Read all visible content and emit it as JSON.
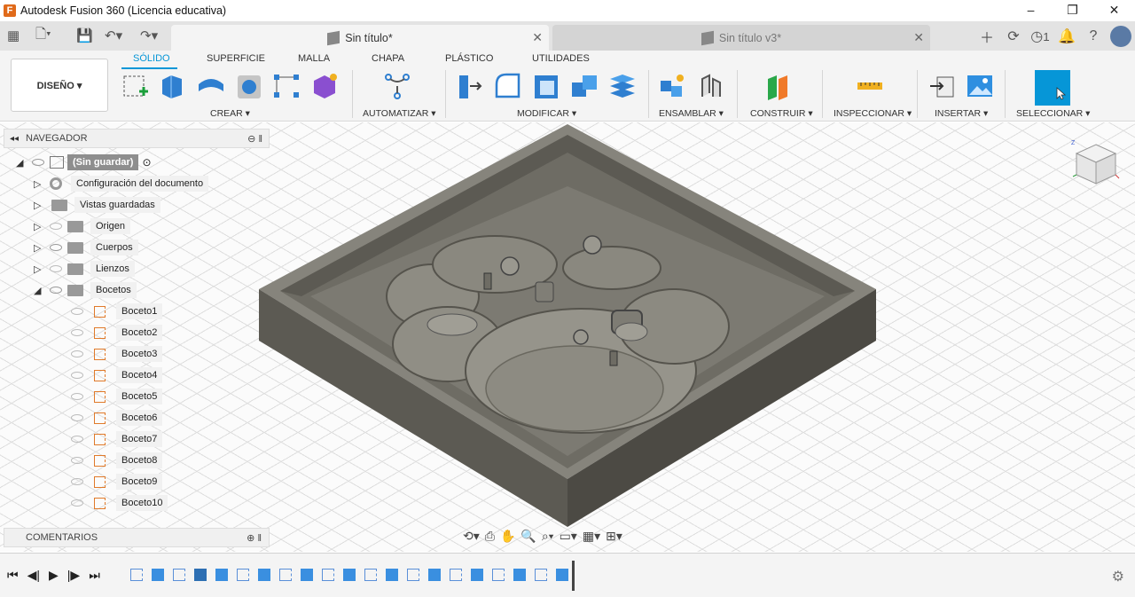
{
  "window": {
    "title": "Autodesk Fusion 360 (Licencia educativa)",
    "controls": [
      "–",
      "❐",
      "✕"
    ]
  },
  "tabs": {
    "active": "Sin título*",
    "inactive": "Sin título v3*",
    "notifications_count": "1"
  },
  "workspace": "DISEÑO ▾",
  "ribbon_tabs": [
    "SÓLIDO",
    "SUPERFICIE",
    "MALLA",
    "CHAPA",
    "PLÁSTICO",
    "UTILIDADES"
  ],
  "groups": [
    "CREAR ▾",
    "AUTOMATIZAR ▾",
    "MODIFICAR ▾",
    "ENSAMBLAR ▾",
    "CONSTRUIR ▾",
    "INSPECCIONAR ▾",
    "INSERTAR ▾",
    "SELECCIONAR ▾"
  ],
  "navigator": {
    "title": "NAVEGADOR",
    "root": "(Sin guardar)",
    "items": [
      "Configuración del documento",
      "Vistas guardadas",
      "Origen",
      "Cuerpos",
      "Lienzos",
      "Bocetos"
    ],
    "sketches": [
      "Boceto1",
      "Boceto2",
      "Boceto3",
      "Boceto4",
      "Boceto5",
      "Boceto6",
      "Boceto7",
      "Boceto8",
      "Boceto9",
      "Boceto10"
    ]
  },
  "comments": "COMENTARIOS",
  "colors": {
    "accent": "#0696d7",
    "model_top": "#7d7b72",
    "model_side": "#5a5850"
  }
}
